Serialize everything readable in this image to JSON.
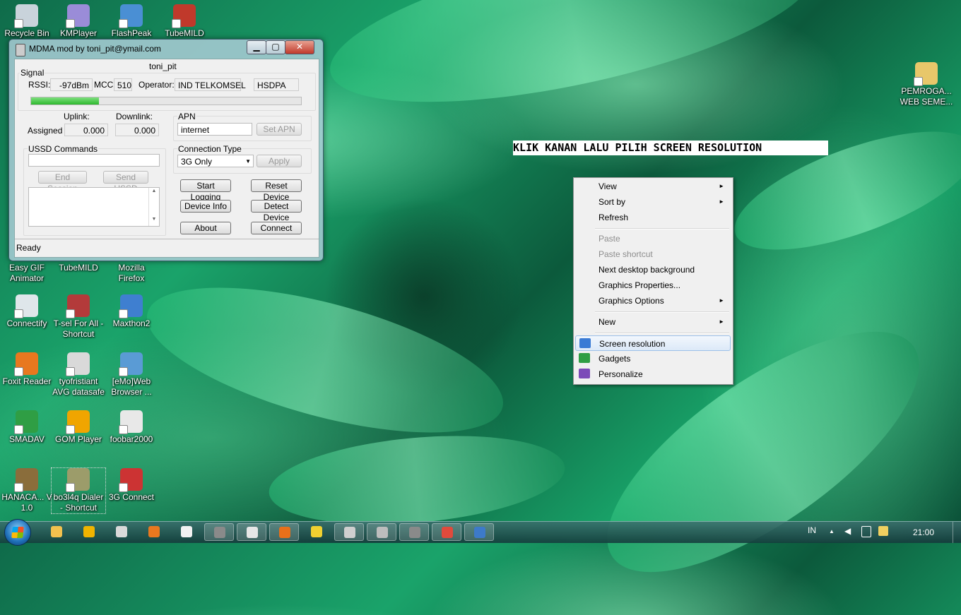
{
  "desktop_icons": [
    {
      "label": "Recycle Bin",
      "color": "#c9d3db"
    },
    {
      "label": "KMPlayer",
      "color": "#9a8cd8"
    },
    {
      "label": "FlashPeak",
      "color": "#4a8fd4"
    },
    {
      "label": "TubeMILD",
      "color": "#c0392b"
    },
    {
      "label": "Easy GIF Animator",
      "color": "#6aa84f"
    },
    {
      "label": "TubeMILD",
      "color": "#c0392b"
    },
    {
      "label": "Mozilla Firefox",
      "color": "#e67e22"
    },
    {
      "label": "Connectify",
      "color": "#dfe6ea"
    },
    {
      "label": "T-sel For All - Shortcut",
      "color": "#b33a3a"
    },
    {
      "label": "Maxthon2",
      "color": "#3f7fd0"
    },
    {
      "label": "Foxit Reader",
      "color": "#e8781f"
    },
    {
      "label": "tyofristiant AVG datasafe",
      "color": "#d9d9d9"
    },
    {
      "label": "[eMo]Web Browser ...",
      "color": "#5a9bd5"
    },
    {
      "label": "SMADAV",
      "color": "#2f9e44"
    },
    {
      "label": "GOM Player",
      "color": "#f0a500"
    },
    {
      "label": "foobar2000",
      "color": "#e8e8e8"
    },
    {
      "label": "HANACA... V 1.0",
      "color": "#8a6d3b"
    },
    {
      "label": "bo3l4q Dialer - Shortcut",
      "color": "#9c9c6a"
    },
    {
      "label": "3G Connect",
      "color": "#cc3333"
    },
    {
      "label": "PEMROGA... WEB SEME...",
      "color": "#e8c76a"
    }
  ],
  "mdma": {
    "title": "MDMA mod by toni_pit@ymail.com",
    "controls": {
      "minimize": "▁",
      "maximize": "▢",
      "close": "✕"
    },
    "user": "toni_pit",
    "signal": {
      "group_label": "Signal",
      "rssi_label": "RSSI:",
      "rssi_value": "-97dBm",
      "mcc_label": "MCC:",
      "mcc_value": "510",
      "operator_label": "Operator:",
      "operator_value": "IND TELKOMSEL",
      "network": "HSDPA",
      "strength_fraction": 0.25
    },
    "throughput": {
      "uplink_label": "Uplink:",
      "downlink_label": "Downlink:",
      "assigned_label": "Assigned",
      "uplink_value": "0.000",
      "downlink_value": "0.000"
    },
    "apn": {
      "group_label": "APN",
      "value": "internet",
      "set_button": "Set APN"
    },
    "ussd": {
      "group_label": "USSD Commands",
      "end_session": "End Session",
      "send": "Send USSD"
    },
    "connection": {
      "group_label": "Connection Type",
      "selected": "3G Only",
      "apply": "Apply"
    },
    "buttons": {
      "start_logging": "Start Logging",
      "reset_device": "Reset Device",
      "device_info": "Device Info",
      "detect_device": "Detect Device",
      "about": "About",
      "connect": "Connect"
    },
    "status": "Ready"
  },
  "annotation": "KLIK KANAN LALU PILIH SCREEN RESOLUTION",
  "context_menu": {
    "items": [
      {
        "label": "View",
        "submenu": true,
        "disabled": false
      },
      {
        "label": "Sort by",
        "submenu": true,
        "disabled": false
      },
      {
        "label": "Refresh",
        "submenu": false,
        "disabled": false
      },
      {
        "label": "Paste",
        "submenu": false,
        "disabled": true
      },
      {
        "label": "Paste shortcut",
        "submenu": false,
        "disabled": true
      },
      {
        "label": "Next desktop background",
        "submenu": false,
        "disabled": false
      },
      {
        "label": "Graphics Properties...",
        "submenu": false,
        "disabled": false
      },
      {
        "label": "Graphics Options",
        "submenu": true,
        "disabled": false
      },
      {
        "label": "New",
        "submenu": true,
        "disabled": false
      },
      {
        "label": "Screen resolution",
        "submenu": false,
        "disabled": false,
        "highlighted": true
      },
      {
        "label": "Gadgets",
        "submenu": false,
        "disabled": false
      },
      {
        "label": "Personalize",
        "submenu": false,
        "disabled": false
      }
    ],
    "arrow": "►"
  },
  "taskbar": {
    "apps": [
      {
        "name": "explorer-icon",
        "color": "#f2c14e"
      },
      {
        "name": "flashpeak-icon",
        "color": "#f0b400"
      },
      {
        "name": "window-icon",
        "color": "#d9d9d9"
      },
      {
        "name": "firefox-icon",
        "color": "#e8781f"
      },
      {
        "name": "opera-icon",
        "color": "#f2f2f2"
      },
      {
        "name": "alien-icon",
        "color": "#8a8a8a"
      },
      {
        "name": "smadav-icon",
        "color": "#e6e6e6"
      },
      {
        "name": "avg-icon",
        "color": "#e8701a"
      },
      {
        "name": "dialer-icon",
        "color": "#f0d030"
      },
      {
        "name": "mdma-icon",
        "color": "#cfcfcf"
      },
      {
        "name": "network-icon",
        "color": "#bdbdbd"
      },
      {
        "name": "alien2-icon",
        "color": "#8a8a8a"
      },
      {
        "name": "chrome-icon",
        "color": "#e04a3c"
      },
      {
        "name": "remote-icon",
        "color": "#3d7ac9"
      }
    ],
    "language": "IN",
    "clock": "21:00"
  }
}
